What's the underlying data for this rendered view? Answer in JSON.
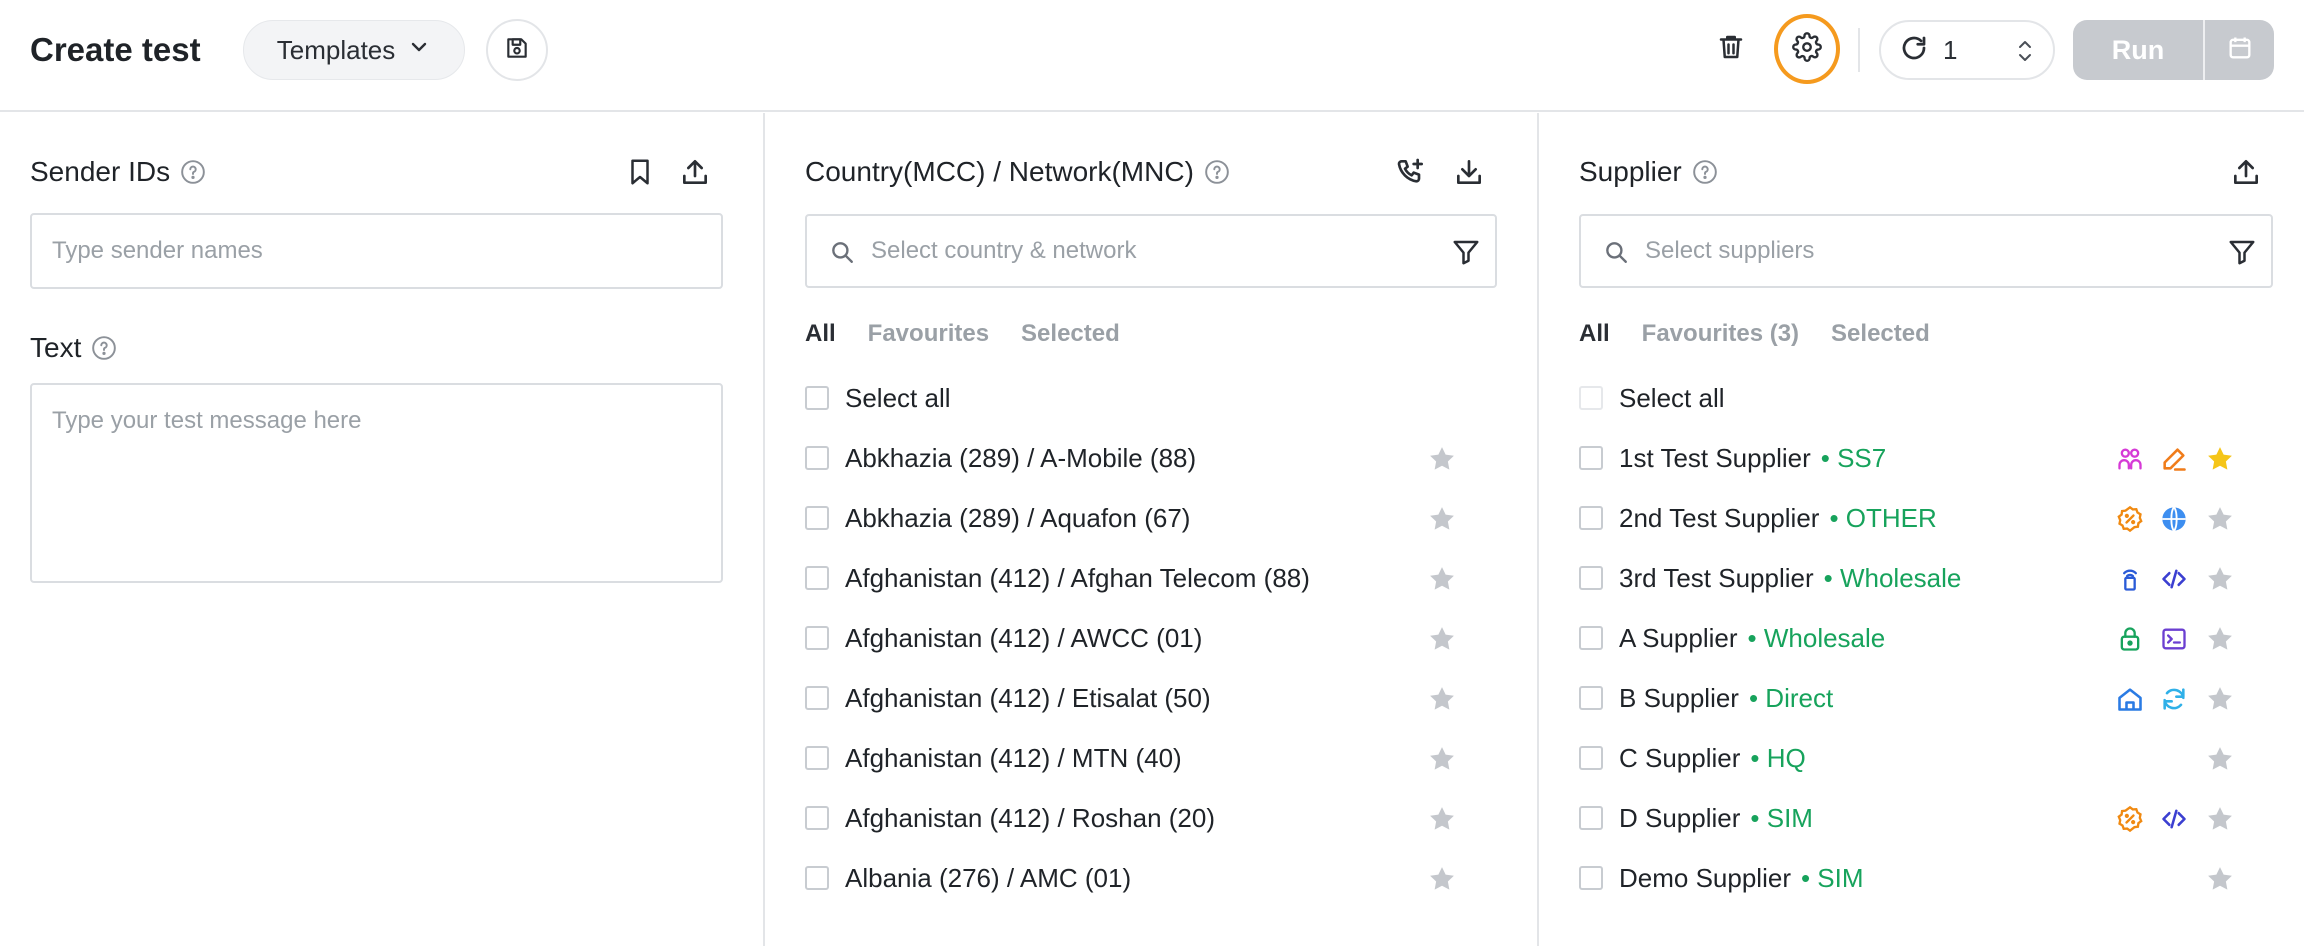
{
  "header": {
    "title": "Create test",
    "templates_label": "Templates",
    "repeat_count": "1",
    "run_label": "Run"
  },
  "sender": {
    "title": "Sender IDs",
    "placeholder": "Type sender names",
    "text_title": "Text",
    "text_placeholder": "Type your test message here"
  },
  "country": {
    "title": "Country(MCC) / Network(MNC)",
    "search_placeholder": "Select country & network",
    "tabs": [
      "All",
      "Favourites",
      "Selected"
    ],
    "select_all": "Select all",
    "items": [
      "Abkhazia (289) / A-Mobile (88)",
      "Abkhazia (289) / Aquafon (67)",
      "Afghanistan (412) / Afghan Telecom (88)",
      "Afghanistan (412) / AWCC (01)",
      "Afghanistan (412) / Etisalat (50)",
      "Afghanistan (412) / MTN (40)",
      "Afghanistan (412) / Roshan (20)",
      "Albania (276) / AMC (01)"
    ]
  },
  "supplier": {
    "title": "Supplier",
    "search_placeholder": "Select suppliers",
    "tabs": [
      "All",
      "Favourites (3)",
      "Selected"
    ],
    "select_all": "Select all",
    "items": [
      {
        "name": "1st Test Supplier",
        "type": "• SS7",
        "icons": [
          "users-icon",
          "edit-icon"
        ],
        "favourite": true
      },
      {
        "name": "2nd Test Supplier",
        "type": "• OTHER",
        "icons": [
          "badge-percent-icon",
          "globe-icon"
        ],
        "favourite": false
      },
      {
        "name": "3rd Test Supplier",
        "type": "• Wholesale",
        "icons": [
          "signal-tower-icon",
          "code-icon"
        ],
        "favourite": false
      },
      {
        "name": "A Supplier",
        "type": "• Wholesale",
        "icons": [
          "lock-icon",
          "terminal-icon"
        ],
        "favourite": false
      },
      {
        "name": "B Supplier",
        "type": "• Direct",
        "icons": [
          "home-icon",
          "refresh-icon"
        ],
        "favourite": false
      },
      {
        "name": "C Supplier",
        "type": "• HQ",
        "icons": [],
        "favourite": false
      },
      {
        "name": "D Supplier",
        "type": "• SIM",
        "icons": [
          "badge-percent-icon",
          "code-icon"
        ],
        "favourite": false
      },
      {
        "name": "Demo Supplier",
        "type": "• SIM",
        "icons": [],
        "favourite": false
      }
    ]
  },
  "colors": {
    "accent_orange": "#f59a1e",
    "type_green": "#17a35c",
    "star_gold": "#f5c518",
    "star_grey": "#c4c7cc"
  }
}
